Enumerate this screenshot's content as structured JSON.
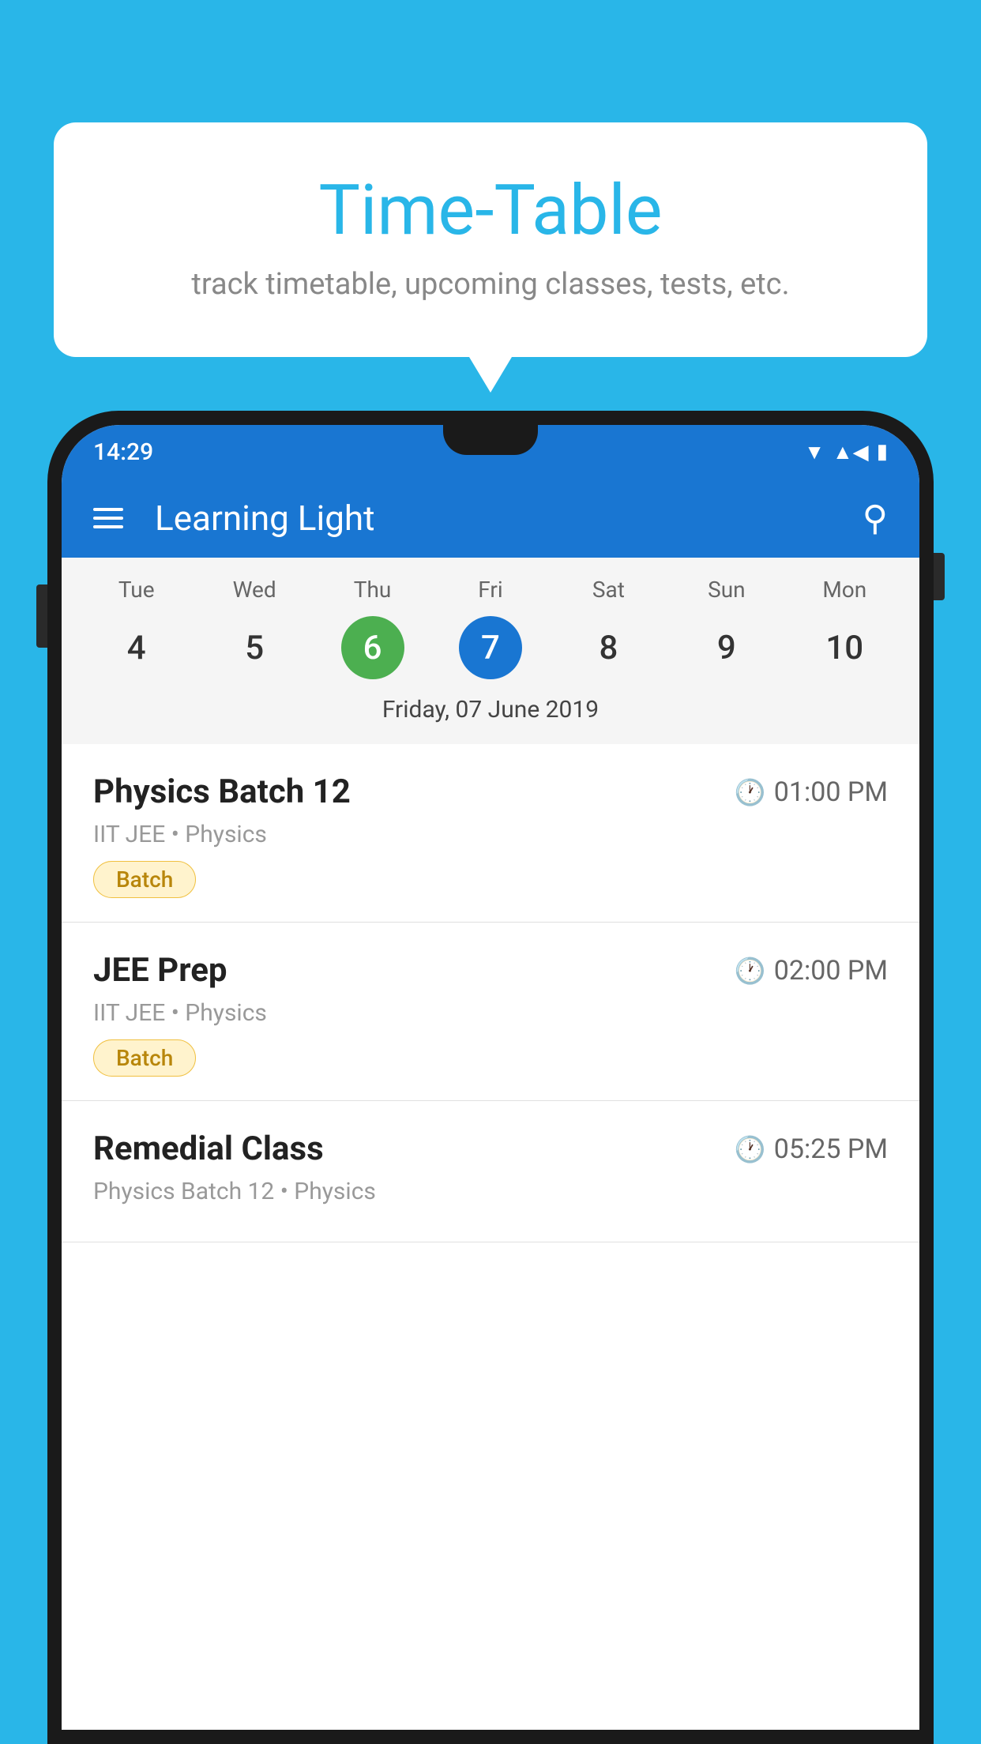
{
  "background_color": "#29B6E8",
  "bubble": {
    "title": "Time-Table",
    "subtitle": "track timetable, upcoming classes, tests, etc."
  },
  "status_bar": {
    "time": "14:29"
  },
  "app_bar": {
    "title": "Learning Light"
  },
  "calendar": {
    "day_labels": [
      "Tue",
      "Wed",
      "Thu",
      "Fri",
      "Sat",
      "Sun",
      "Mon"
    ],
    "dates": [
      "4",
      "5",
      "6",
      "7",
      "8",
      "9",
      "10"
    ],
    "today_index": 2,
    "selected_index": 3,
    "selected_label": "Friday, 07 June 2019"
  },
  "schedule": [
    {
      "title": "Physics Batch 12",
      "time": "01:00 PM",
      "subtitle": "IIT JEE • Physics",
      "badge": "Batch"
    },
    {
      "title": "JEE Prep",
      "time": "02:00 PM",
      "subtitle": "IIT JEE • Physics",
      "badge": "Batch"
    },
    {
      "title": "Remedial Class",
      "time": "05:25 PM",
      "subtitle": "Physics Batch 12 • Physics",
      "badge": null
    }
  ],
  "icons": {
    "hamburger": "☰",
    "search": "🔍",
    "clock": "🕐"
  }
}
